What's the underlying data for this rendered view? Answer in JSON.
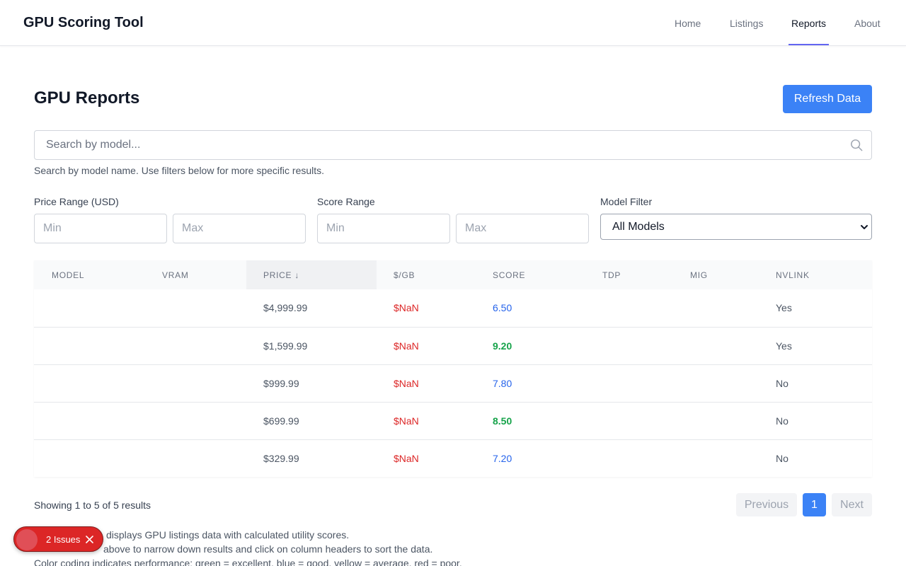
{
  "header": {
    "brand": "GPU Scoring Tool",
    "nav": [
      {
        "label": "Home",
        "active": false
      },
      {
        "label": "Listings",
        "active": false
      },
      {
        "label": "Reports",
        "active": true
      },
      {
        "label": "About",
        "active": false
      }
    ]
  },
  "page": {
    "title": "GPU Reports",
    "refresh_label": "Refresh Data"
  },
  "search": {
    "placeholder": "Search by model...",
    "value": "",
    "help": "Search by model name. Use filters below for more specific results."
  },
  "filters": {
    "price_label": "Price Range (USD)",
    "price_min_placeholder": "Min",
    "price_max_placeholder": "Max",
    "score_label": "Score Range",
    "score_min_placeholder": "Min",
    "score_max_placeholder": "Max",
    "model_label": "Model Filter",
    "model_selected": "All Models"
  },
  "table": {
    "columns": [
      "MODEL",
      "VRAM",
      "PRICE ↓",
      "$/GB",
      "SCORE",
      "TDP",
      "MIG",
      "NVLINK"
    ],
    "rows": [
      {
        "model": "",
        "vram": "",
        "price": "$4,999.99",
        "ppgb": "$NaN",
        "score": "6.50",
        "score_level": "good",
        "tdp": "",
        "mig": "",
        "nvlink": "Yes"
      },
      {
        "model": "",
        "vram": "",
        "price": "$1,599.99",
        "ppgb": "$NaN",
        "score": "9.20",
        "score_level": "excellent",
        "tdp": "",
        "mig": "",
        "nvlink": "Yes"
      },
      {
        "model": "",
        "vram": "",
        "price": "$999.99",
        "ppgb": "$NaN",
        "score": "7.80",
        "score_level": "good",
        "tdp": "",
        "mig": "",
        "nvlink": "No"
      },
      {
        "model": "",
        "vram": "",
        "price": "$699.99",
        "ppgb": "$NaN",
        "score": "8.50",
        "score_level": "excellent",
        "tdp": "",
        "mig": "",
        "nvlink": "No"
      },
      {
        "model": "",
        "vram": "",
        "price": "$329.99",
        "ppgb": "$NaN",
        "score": "7.20",
        "score_level": "good",
        "tdp": "",
        "mig": "",
        "nvlink": "No"
      }
    ]
  },
  "pagination": {
    "summary": "Showing 1 to 5 of 5 results",
    "previous": "Previous",
    "current_page": "1",
    "next": "Next"
  },
  "notes": [
    "displays GPU listings data with calculated utility scores.",
    "above to narrow down results and click on column headers to sort the data.",
    "Color coding indicates performance: green = excellent, blue = good, yellow = average, red = poor."
  ],
  "issues": {
    "label": "2 Issues"
  },
  "colors": {
    "accent": "#3b82f6",
    "nav_indicator": "#6366f1",
    "score_excellent": "#16a34a",
    "score_good": "#2563eb",
    "poor_value": "#dc2626",
    "issues_badge": "#dc2626"
  },
  "icons": {
    "search": "search-icon",
    "select": "chevron-down-icon",
    "issues_close": "close-icon"
  }
}
